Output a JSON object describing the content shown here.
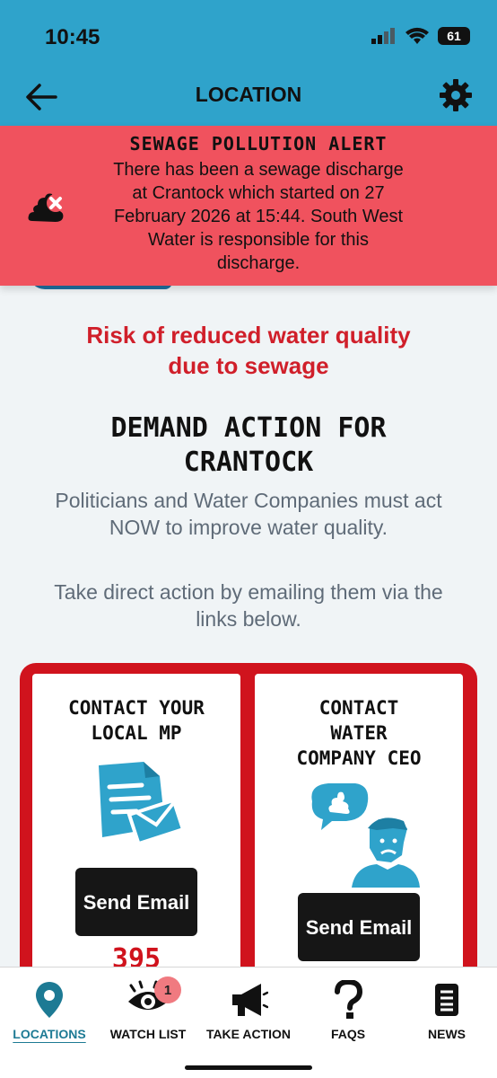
{
  "status_bar": {
    "time": "10:45",
    "battery": "61"
  },
  "header": {
    "title": "LOCATION"
  },
  "alert": {
    "title": "SEWAGE POLLUTION ALERT",
    "body": "There has been a sewage discharge at Crantock which started on 27 February 2026 at 15:44. South West Water is responsible for this discharge.",
    "icon": "poo-cross-icon"
  },
  "main": {
    "risk_line1": "Risk of reduced water quality",
    "risk_line2": "due to sewage",
    "demand_line1": "DEMAND ACTION FOR",
    "demand_line2": "CRANTOCK",
    "politicians_text": "Politicians and Water Companies must act NOW to improve water quality.",
    "direct_action_text": "Take direct action by emailing them via the links below."
  },
  "cards": [
    {
      "title_line1": "CONTACT YOUR",
      "title_line2": "LOCAL MP",
      "button": "Send Email",
      "count": "395",
      "icon": "document-envelope-icon"
    },
    {
      "title_line1": "CONTACT",
      "title_line2": "WATER",
      "title_line3": "COMPANY CEO",
      "button": "Send Email",
      "icon": "sad-person-speech-icon"
    }
  ],
  "bottom_nav": [
    {
      "label": "LOCATIONS",
      "icon": "location-pin-icon",
      "active": true
    },
    {
      "label": "WATCH LIST",
      "icon": "eye-icon",
      "badge": "1"
    },
    {
      "label": "TAKE ACTION",
      "icon": "megaphone-icon"
    },
    {
      "label": "FAQS",
      "icon": "question-mark-icon"
    },
    {
      "label": "NEWS",
      "icon": "news-icon"
    }
  ],
  "colors": {
    "header": "#2fa3cb",
    "alert": "#f0525e",
    "accent_red": "#d0131d",
    "active_nav": "#1d7a94"
  }
}
